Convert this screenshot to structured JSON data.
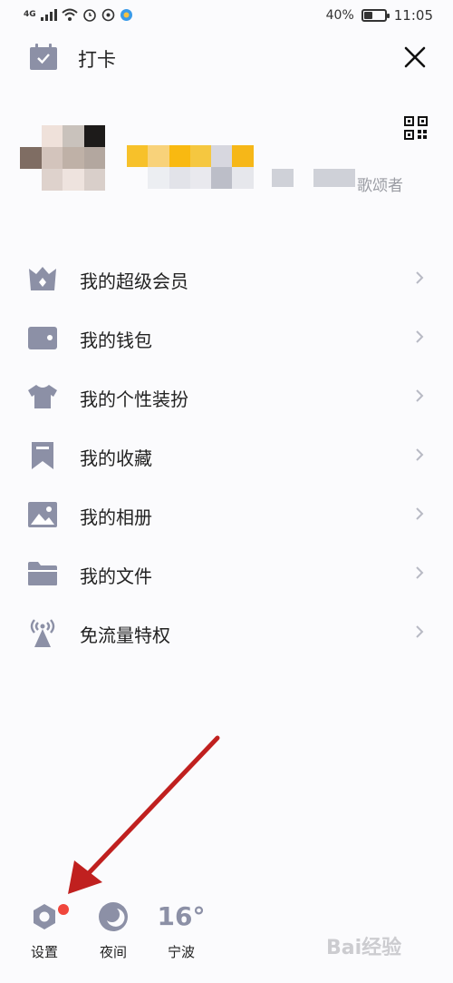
{
  "status_bar": {
    "network": "4G",
    "battery": "40%",
    "battery_level": 0.4,
    "time": "11:05"
  },
  "header": {
    "checkin_label": "打卡",
    "close_icon": "close-icon",
    "checkin_icon": "calendar-check-icon"
  },
  "profile": {
    "signature_suffix": "歌颂者",
    "qr_icon": "qr-code-icon"
  },
  "menu": {
    "items": [
      {
        "label": "我的超级会员",
        "icon": "crown-icon"
      },
      {
        "label": "我的钱包",
        "icon": "wallet-icon"
      },
      {
        "label": "我的个性装扮",
        "icon": "tshirt-icon"
      },
      {
        "label": "我的收藏",
        "icon": "bookmark-icon"
      },
      {
        "label": "我的相册",
        "icon": "photo-icon"
      },
      {
        "label": "我的文件",
        "icon": "folder-icon"
      },
      {
        "label": "免流量特权",
        "icon": "signal-tower-icon"
      }
    ]
  },
  "bottom": {
    "settings_label": "设置",
    "night_label": "夜间",
    "temperature": "16°",
    "city": "宁波"
  },
  "watermark": "Bai经验",
  "colors": {
    "icon_gray": "#8c90a6",
    "badge_red": "#f0463c",
    "arrow_red": "#c0201f",
    "background": "#fbfbfd"
  }
}
